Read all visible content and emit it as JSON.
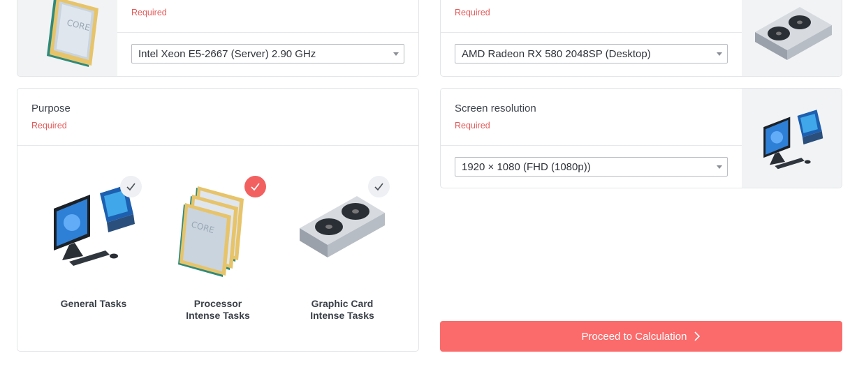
{
  "processor": {
    "required": "Required",
    "selected": "Intel Xeon E5-2667 (Server) 2.90 GHz"
  },
  "graphics": {
    "required": "Required",
    "selected": "AMD Radeon RX 580 2048SP (Desktop)"
  },
  "purpose": {
    "label": "Purpose",
    "required": "Required",
    "options": [
      {
        "line1": "General Tasks",
        "line2": "",
        "selected": false,
        "icon": "desktop-pc-icon"
      },
      {
        "line1": "Processor",
        "line2": "Intense Tasks",
        "selected": true,
        "icon": "processor-chips-icon"
      },
      {
        "line1": "Graphic Card",
        "line2": "Intense Tasks",
        "selected": false,
        "icon": "graphics-card-icon"
      }
    ]
  },
  "resolution": {
    "label": "Screen resolution",
    "required": "Required",
    "selected": "1920 × 1080 (FHD (1080p))"
  },
  "proceed": {
    "label": "Proceed to Calculation"
  },
  "colors": {
    "accent": "#fb6b6b",
    "required": "#e55a5a",
    "check_selected": "#f26060"
  }
}
